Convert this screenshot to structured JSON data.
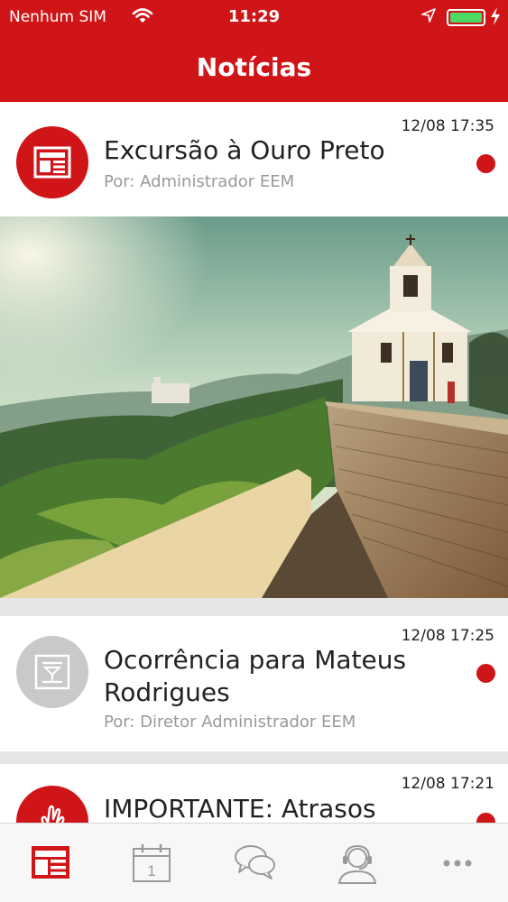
{
  "status_bar": {
    "carrier": "Nenhum SIM",
    "time": "11:29",
    "battery_color": "#4cd964"
  },
  "header": {
    "title": "Notícias",
    "color": "#d01519"
  },
  "news": [
    {
      "datetime": "12/08 17:35",
      "title": "Excursão à Ouro Preto",
      "author": "Por: Administrador EEM",
      "icon": "newspaper-icon",
      "unread": true,
      "has_image": true
    },
    {
      "datetime": "12/08 17:25",
      "title": "Ocorrência para Mateus Rodrigues",
      "author": "Por: Diretor Administrador EEM",
      "icon": "notice-icon",
      "unread": true,
      "has_image": false
    },
    {
      "datetime": "12/08 17:21",
      "title": "IMPORTANTE: Atrasos",
      "icon": "hand-icon",
      "unread": true,
      "has_image": false
    }
  ],
  "tabbar": {
    "items": [
      {
        "icon": "news-icon",
        "active": true
      },
      {
        "icon": "calendar-icon",
        "date": "1",
        "active": false
      },
      {
        "icon": "chat-icon",
        "active": false
      },
      {
        "icon": "contact-icon",
        "active": false
      },
      {
        "icon": "more-icon",
        "active": false
      }
    ]
  }
}
